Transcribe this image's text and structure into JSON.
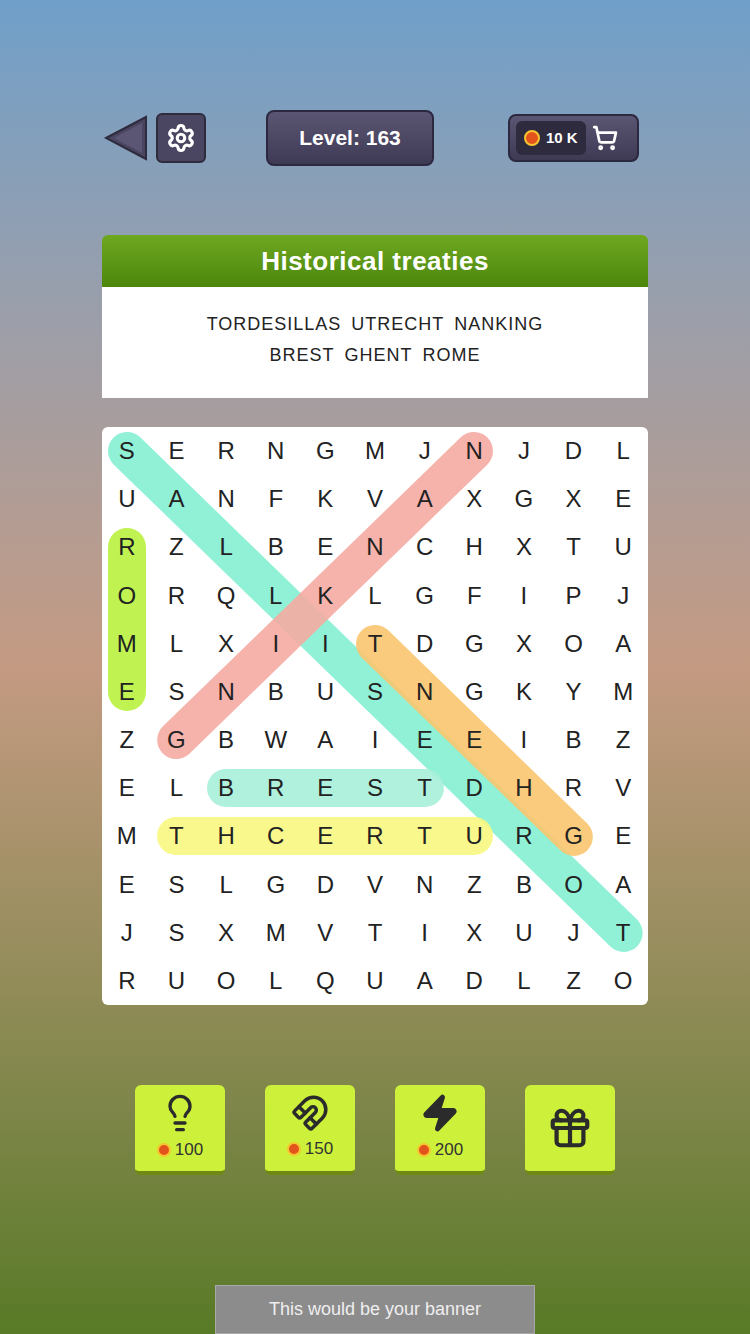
{
  "top_bar": {
    "level_label": "Level: 163",
    "coins": "10 K"
  },
  "puzzle": {
    "title": "Historical treaties",
    "word_lines": [
      [
        "TORDESILLAS",
        "UTRECHT",
        "NANKING"
      ],
      [
        "BREST",
        "GHENT",
        "ROME"
      ]
    ]
  },
  "grid": [
    [
      "S",
      "E",
      "R",
      "N",
      "G",
      "M",
      "J",
      "N",
      "J",
      "D",
      "L"
    ],
    [
      "U",
      "A",
      "N",
      "F",
      "K",
      "V",
      "A",
      "X",
      "G",
      "X",
      "E"
    ],
    [
      "R",
      "Z",
      "L",
      "B",
      "E",
      "N",
      "C",
      "H",
      "X",
      "T",
      "U"
    ],
    [
      "O",
      "R",
      "Q",
      "L",
      "K",
      "L",
      "G",
      "F",
      "I",
      "P",
      "J"
    ],
    [
      "M",
      "L",
      "X",
      "I",
      "I",
      "T",
      "D",
      "G",
      "X",
      "O",
      "A"
    ],
    [
      "E",
      "S",
      "N",
      "B",
      "U",
      "S",
      "N",
      "G",
      "K",
      "Y",
      "M"
    ],
    [
      "Z",
      "G",
      "B",
      "W",
      "A",
      "I",
      "E",
      "E",
      "I",
      "B",
      "Z"
    ],
    [
      "E",
      "L",
      "B",
      "R",
      "E",
      "S",
      "T",
      "D",
      "H",
      "R",
      "V"
    ],
    [
      "M",
      "T",
      "H",
      "C",
      "E",
      "R",
      "T",
      "U",
      "R",
      "G",
      "E"
    ],
    [
      "E",
      "S",
      "L",
      "G",
      "D",
      "V",
      "N",
      "Z",
      "B",
      "O",
      "A"
    ],
    [
      "J",
      "S",
      "X",
      "M",
      "V",
      "T",
      "I",
      "X",
      "U",
      "J",
      "T"
    ],
    [
      "R",
      "U",
      "O",
      "L",
      "Q",
      "U",
      "A",
      "D",
      "L",
      "Z",
      "O"
    ]
  ],
  "highlights": [
    {
      "color": "#84f0d3",
      "start": [
        0,
        0
      ],
      "end": [
        10,
        10
      ]
    },
    {
      "color": "#f5aba3",
      "start": [
        0,
        7
      ],
      "end": [
        6,
        1
      ]
    },
    {
      "color": "#b9f23f",
      "start": [
        2,
        0
      ],
      "end": [
        5,
        0
      ]
    },
    {
      "color": "#f9c56e",
      "start": [
        4,
        5
      ],
      "end": [
        8,
        9
      ]
    },
    {
      "color": "#a6f0d9",
      "start": [
        7,
        2
      ],
      "end": [
        7,
        6
      ]
    },
    {
      "color": "#f8f77f",
      "start": [
        8,
        1
      ],
      "end": [
        8,
        7
      ]
    }
  ],
  "boosters": [
    {
      "kind": "hint",
      "cost": "100"
    },
    {
      "kind": "magnet",
      "cost": "150"
    },
    {
      "kind": "lightning",
      "cost": "200"
    },
    {
      "kind": "video"
    }
  ],
  "banner": {
    "text": "This would be your banner"
  }
}
